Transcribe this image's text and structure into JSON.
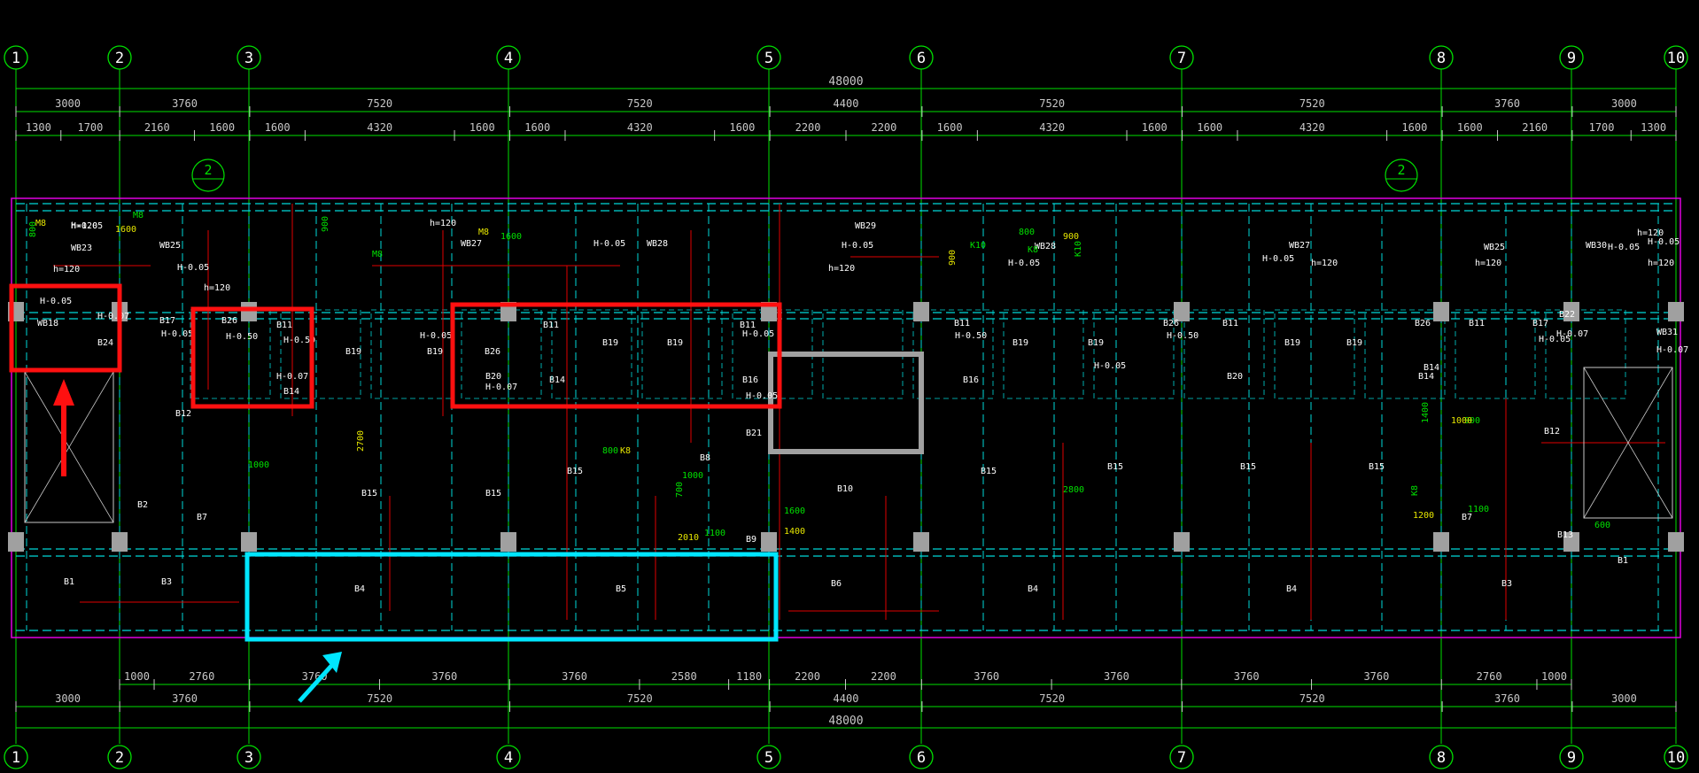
{
  "drawing": {
    "axis_labels_top": [
      "1",
      "2",
      "3",
      "4",
      "5",
      "6",
      "7",
      "8",
      "9",
      "10"
    ],
    "axis_labels_bottom": [
      "1",
      "2",
      "3",
      "4",
      "5",
      "6",
      "7",
      "8",
      "9",
      "10"
    ],
    "dim_total_top": "48000",
    "dim_total_bottom": "48000",
    "dims_top_row1": [
      "3000",
      "3760",
      "7520",
      "7520",
      "4400",
      "7520",
      "7520",
      "3760",
      "3000"
    ],
    "dims_top_row2": [
      "1300",
      "1700",
      "2160",
      "1600",
      "1600",
      "4320",
      "1600",
      "1600",
      "4320",
      "1600",
      "2200",
      "2200",
      "1600",
      "4320",
      "1600",
      "1600",
      "4320",
      "1600",
      "1600",
      "2160",
      "1700",
      "1300"
    ],
    "dims_bottom_row1": [
      "1000",
      "2760",
      "3760",
      "3760",
      "3760",
      "2580",
      "1180",
      "2200",
      "2200",
      "3760",
      "3760",
      "3760",
      "3760",
      "2760",
      "1000"
    ],
    "dims_bottom_row2": [
      "3000",
      "3760",
      "7520",
      "7520",
      "4400",
      "7520",
      "7520",
      "3760",
      "3000"
    ],
    "section_marker": "2",
    "slab_labels": [
      {
        "text": "H-0.05"
      },
      {
        "text": "WB23"
      },
      {
        "text": "h=120"
      },
      {
        "text": "WB25"
      },
      {
        "text": "H-0.05"
      },
      {
        "text": "h=120"
      },
      {
        "text": "WB27"
      },
      {
        "text": "H-0.05"
      },
      {
        "text": "WB28"
      },
      {
        "text": "h=120"
      },
      {
        "text": "WB29"
      },
      {
        "text": "H-0.05"
      },
      {
        "text": "h=120"
      },
      {
        "text": "WB28"
      },
      {
        "text": "H-0.05"
      },
      {
        "text": "h=120"
      },
      {
        "text": "WB27"
      },
      {
        "text": "H-0.05"
      },
      {
        "text": "h=120"
      },
      {
        "text": "WB25"
      },
      {
        "text": "H-0.05"
      },
      {
        "text": "h=120"
      },
      {
        "text": "WB30"
      },
      {
        "text": "H-0.05"
      },
      {
        "text": "h=120"
      },
      {
        "text": "B17"
      },
      {
        "text": "H-0.05"
      },
      {
        "text": "B26"
      },
      {
        "text": "H-0.50"
      },
      {
        "text": "B11"
      },
      {
        "text": "H-0.50"
      },
      {
        "text": "B19"
      },
      {
        "text": "H-0.05"
      },
      {
        "text": "B19"
      },
      {
        "text": "B26"
      },
      {
        "text": "B11"
      },
      {
        "text": "B19"
      },
      {
        "text": "B19"
      },
      {
        "text": "B11"
      },
      {
        "text": "H-0.05"
      },
      {
        "text": "B16"
      },
      {
        "text": "H-0.05"
      },
      {
        "text": "B11"
      },
      {
        "text": "H-0.50"
      },
      {
        "text": "B19"
      },
      {
        "text": "B19"
      },
      {
        "text": "H-0.05"
      },
      {
        "text": "B26"
      },
      {
        "text": "H-0.50"
      },
      {
        "text": "B11"
      },
      {
        "text": "B19"
      },
      {
        "text": "B19"
      },
      {
        "text": "B26"
      },
      {
        "text": "B11"
      },
      {
        "text": "B17"
      },
      {
        "text": "H-0.05"
      },
      {
        "text": "B22"
      },
      {
        "text": "H-0.07"
      },
      {
        "text": "WB31"
      },
      {
        "text": "B12"
      },
      {
        "text": "B15"
      },
      {
        "text": "B15"
      },
      {
        "text": "B15"
      },
      {
        "text": "B21"
      },
      {
        "text": "B8"
      },
      {
        "text": "B10"
      },
      {
        "text": "B15"
      },
      {
        "text": "B15"
      },
      {
        "text": "B15"
      },
      {
        "text": "B15"
      },
      {
        "text": "B12"
      },
      {
        "text": "B2"
      },
      {
        "text": "B7"
      },
      {
        "text": "B9"
      },
      {
        "text": "B7"
      },
      {
        "text": "B13"
      },
      {
        "text": "B1"
      },
      {
        "text": "B3"
      },
      {
        "text": "B4"
      },
      {
        "text": "B5"
      },
      {
        "text": "B6"
      },
      {
        "text": "B4"
      },
      {
        "text": "B4"
      },
      {
        "text": "B3"
      },
      {
        "text": "B1"
      },
      {
        "text": "H-0.05"
      },
      {
        "text": "WB18"
      },
      {
        "text": "B24"
      },
      {
        "text": "H-0.07"
      },
      {
        "text": "H-0.07"
      },
      {
        "text": "B14"
      },
      {
        "text": "B20"
      },
      {
        "text": "H-0.07"
      },
      {
        "text": "B14"
      },
      {
        "text": "B16"
      },
      {
        "text": "B20"
      },
      {
        "text": "B14"
      },
      {
        "text": "B14"
      },
      {
        "text": "H-0.07"
      },
      {
        "text": "h=120"
      }
    ],
    "rebar_labels": [
      "M8",
      "800",
      "M8",
      "1600",
      "M8",
      "900",
      "M8",
      "1600",
      "K10",
      "900",
      "800",
      "K8",
      "900",
      "K10",
      "800",
      "K8",
      "1000",
      "700",
      "2010",
      "1100",
      "1000",
      "2700",
      "2800",
      "1600",
      "1400",
      "1400",
      "900",
      "1200",
      "1100",
      "K8",
      "1000",
      "600"
    ],
    "colors": {
      "background": "#000000",
      "axis": "#00e000",
      "dim": "#c8c8c8",
      "beam": "#00d8d8",
      "text": "#ffffff",
      "rebar_green": "#00e000",
      "rebar_yellow": "#e6e600",
      "red_line": "#e00000",
      "outline": "#e000e0",
      "column": "#a0a0a0",
      "highlight_red": "#ff1010",
      "highlight_cyan": "#00e6ff"
    }
  }
}
